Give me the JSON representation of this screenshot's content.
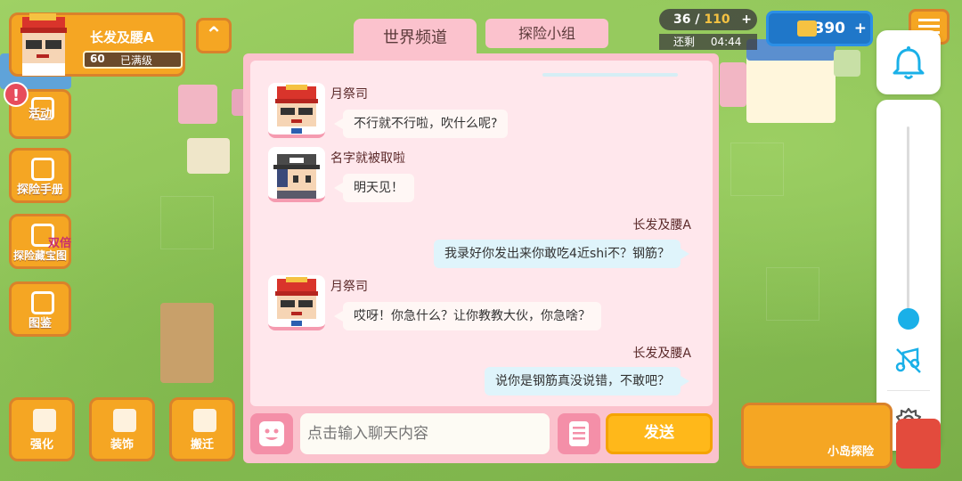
{
  "player": {
    "name": "长发及腰A",
    "level": "60",
    "level_status": "已满级"
  },
  "hud": {
    "energy_current": "36",
    "energy_sep": " / ",
    "energy_max": "110",
    "remain_label": "还剩",
    "remain_time": "04:44",
    "coins": "1,390"
  },
  "left_menu": [
    {
      "label": "活动"
    },
    {
      "label": "探险手册"
    },
    {
      "label": "探险藏宝图",
      "tag": "双倍"
    },
    {
      "label": "图鉴"
    }
  ],
  "bottom_menu": [
    {
      "label": "强化"
    },
    {
      "label": "装饰"
    },
    {
      "label": "搬迁"
    }
  ],
  "island_label": "小岛探险",
  "chat": {
    "tabs": [
      {
        "label": "世界频道",
        "active": true
      },
      {
        "label": "探险小组",
        "active": false
      }
    ],
    "messages": [
      {
        "side": "left",
        "sender": "月祭司",
        "text": "不行就不行啦，吹什么呢?",
        "avatar": "red-hat-avatar"
      },
      {
        "side": "left",
        "sender": "名字就被取啦",
        "text": "明天见！",
        "avatar": "dark-hat-avatar"
      },
      {
        "side": "right",
        "sender": "长发及腰A",
        "text": "我录好你发出来你敢吃4近shi不？钢筋？"
      },
      {
        "side": "left",
        "sender": "月祭司",
        "text": "哎呀！你急什么？让你教教大伙，你急啥？",
        "avatar": "red-hat-avatar"
      },
      {
        "side": "right",
        "sender": "长发及腰A",
        "text": "说你是钢筋真没说错，不敢吧？"
      }
    ],
    "input_placeholder": "点击输入聊天内容",
    "send_label": "发送"
  },
  "colors": {
    "accent_orange": "#f5a623",
    "chat_pink": "#fbc2cd",
    "send_yellow": "#ffb81a",
    "slider_blue": "#1ab0e8"
  }
}
